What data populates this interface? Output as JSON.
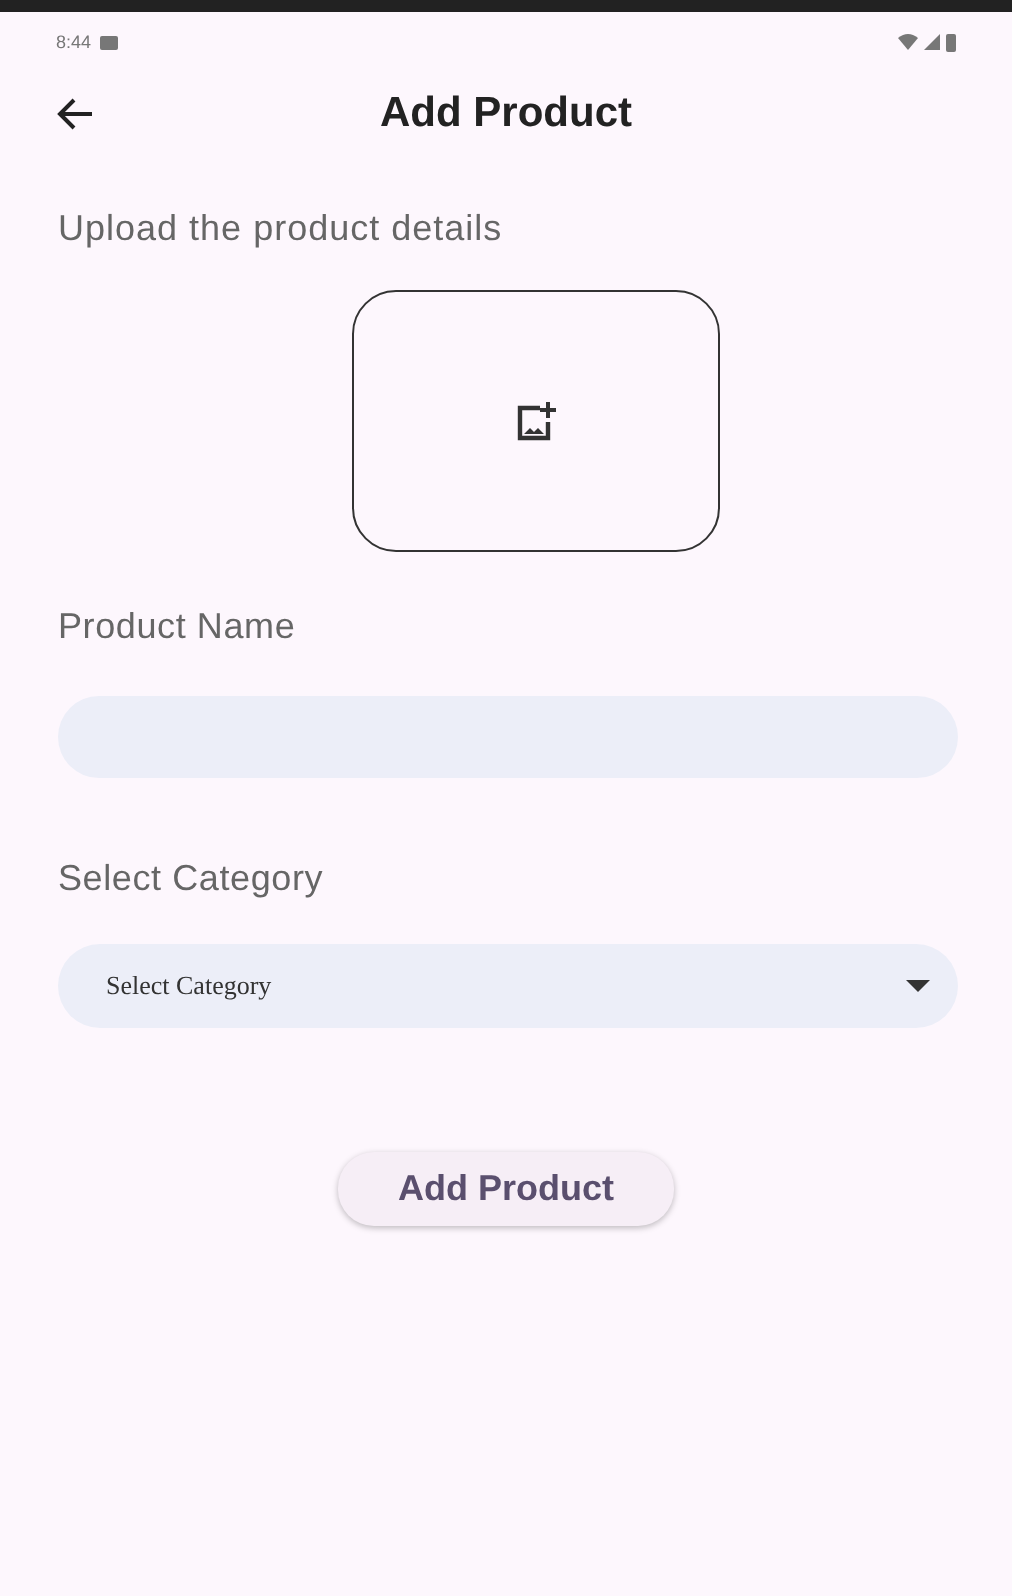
{
  "status_bar": {
    "time": "8:44"
  },
  "app_bar": {
    "title": "Add Product"
  },
  "heading": "Upload the product details",
  "fields": [
    {
      "kind": "text",
      "label": "Product Name"
    },
    {
      "kind": "dropdown",
      "label": "Select Category",
      "value": "Select Category"
    }
  ],
  "submit_button": "Add Product"
}
